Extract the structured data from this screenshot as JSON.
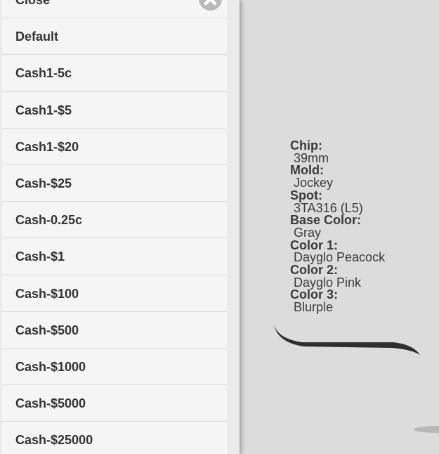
{
  "menu": {
    "close_label": "Close",
    "close_icon": "close-icon",
    "items": [
      {
        "label": "Default"
      },
      {
        "label": "Cash1-5c"
      },
      {
        "label": "Cash1-$5"
      },
      {
        "label": "Cash1-$20"
      },
      {
        "label": "Cash-$25"
      },
      {
        "label": "Cash-0.25c"
      },
      {
        "label": "Cash-$1"
      },
      {
        "label": "Cash-$100"
      },
      {
        "label": "Cash-$500"
      },
      {
        "label": "Cash-$1000"
      },
      {
        "label": "Cash-$5000"
      },
      {
        "label": "Cash-$25000"
      }
    ]
  },
  "chip": {
    "chip_label": "Chip:",
    "chip_value": "39mm",
    "mold_label": "Mold:",
    "mold_value": "Jockey",
    "spot_label": "Spot:",
    "spot_value": "3TA316 (L5)",
    "base_label": "Base Color:",
    "base_value": "Gray",
    "color1_label": "Color 1:",
    "color1_value": "Dayglo Peacock",
    "color2_label": "Color 2:",
    "color2_value": "Dayglo Pink",
    "color3_label": "Color 3:",
    "color3_value": "Blurple"
  },
  "colors": {
    "panel_bg": "#f5f5f5",
    "canvas_bg": "#dcdcdc",
    "text": "#333333"
  }
}
